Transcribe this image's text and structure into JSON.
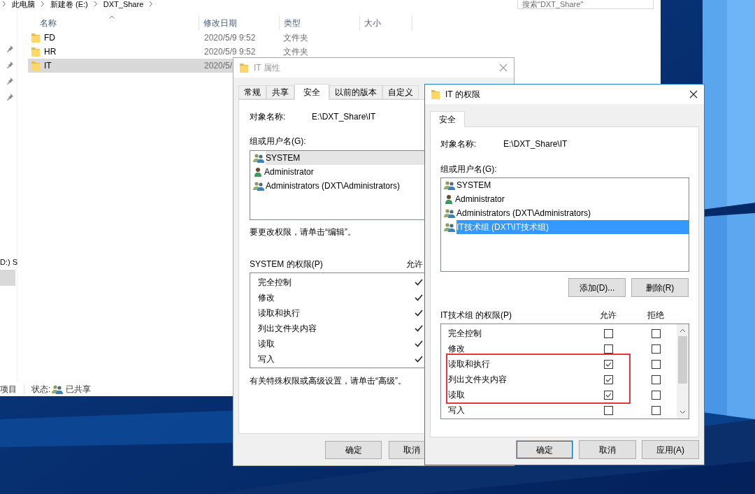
{
  "explorer": {
    "breadcrumb": [
      "此电脑",
      "新建卷 (E:)",
      "DXT_Share"
    ],
    "search": {
      "placeholder": "搜索\"DXT_Share\""
    },
    "nav_label": "D:) S",
    "columns": [
      "名称",
      "修改日期",
      "类型",
      "大小"
    ],
    "files": [
      {
        "name": "FD",
        "modified": "2020/5/9 9:52",
        "type": "文件夹",
        "selected": false
      },
      {
        "name": "HR",
        "modified": "2020/5/9 9:52",
        "type": "文件夹",
        "selected": false
      },
      {
        "name": "IT",
        "modified": "2020/5/",
        "selected": true
      }
    ],
    "status_bar": {
      "count": "项目",
      "state_label": "状态:",
      "state": "已共享"
    }
  },
  "properties_dialog": {
    "title": "IT 属性",
    "active": false,
    "tabs": [
      {
        "label": "常规",
        "selected": false
      },
      {
        "label": "共享",
        "selected": false
      },
      {
        "label": "安全",
        "selected": true
      },
      {
        "label": "以前的版本",
        "selected": false
      },
      {
        "label": "自定义",
        "selected": false
      }
    ],
    "object_label": "对象名称:",
    "object_name": "E:\\DXT_Share\\IT",
    "principals_label": "组或用户名(G):",
    "principals": [
      {
        "name": "SYSTEM",
        "kind": "group",
        "selected": true
      },
      {
        "name": "Administrator",
        "kind": "user",
        "selected": false
      },
      {
        "name": "Administrators (DXT\\Administrators)",
        "kind": "group",
        "selected": false
      }
    ],
    "edit_hint": "要更改权限，请单击“编辑”。",
    "permissions_label": "SYSTEM 的权限(P)",
    "allow_header": "允许",
    "permissions": [
      {
        "name": "完全控制",
        "allow": true
      },
      {
        "name": "修改",
        "allow": true
      },
      {
        "name": "读取和执行",
        "allow": true
      },
      {
        "name": "列出文件夹内容",
        "allow": true
      },
      {
        "name": "读取",
        "allow": true
      },
      {
        "name": "写入",
        "allow": true
      }
    ],
    "advanced_hint": "有关特殊权限或高级设置，请单击“高级”。",
    "buttons": [
      "确定",
      "取消"
    ]
  },
  "permissions_dialog": {
    "title": "IT 的权限",
    "active": true,
    "tabs": [
      {
        "label": "安全",
        "selected": true
      }
    ],
    "object_label": "对象名称:",
    "object_name": "E:\\DXT_Share\\IT",
    "principals_label": "组或用户名(G):",
    "principals": [
      {
        "name": "SYSTEM",
        "kind": "group",
        "selected": false
      },
      {
        "name": "Administrator",
        "kind": "user",
        "selected": false
      },
      {
        "name": "Administrators (DXT\\Administrators)",
        "kind": "group",
        "selected": false
      },
      {
        "name": "IT技术组 (DXT\\IT技术组)",
        "kind": "group",
        "selected": true
      }
    ],
    "list_buttons": [
      "添加(D)...",
      "删除(R)"
    ],
    "permissions_label": "IT技术组 的权限(P)",
    "allow_header": "允许",
    "deny_header": "拒绝",
    "permissions": [
      {
        "name": "完全控制",
        "allow": false,
        "deny": false
      },
      {
        "name": "修改",
        "allow": false,
        "deny": false
      },
      {
        "name": "读取和执行",
        "allow": true,
        "deny": false
      },
      {
        "name": "列出文件夹内容",
        "allow": true,
        "deny": false
      },
      {
        "name": "读取",
        "allow": true,
        "deny": false
      },
      {
        "name": "写入",
        "allow": false,
        "deny": false
      }
    ],
    "buttons": [
      {
        "label": "确定",
        "default": true
      },
      {
        "label": "取消",
        "default": false
      },
      {
        "label": "应用(A)",
        "default": false
      }
    ]
  }
}
